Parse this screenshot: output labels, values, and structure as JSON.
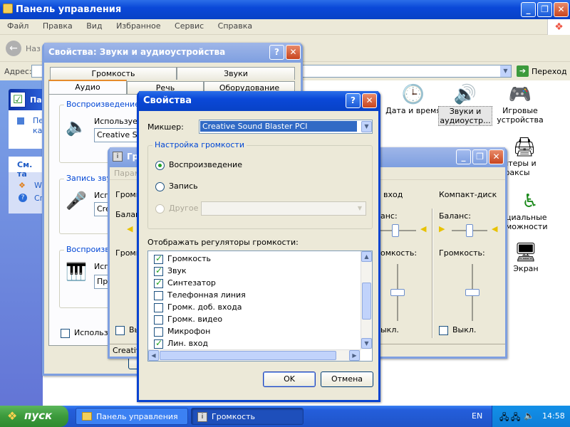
{
  "cp": {
    "title": "Панель управления",
    "menu": [
      "Файл",
      "Правка",
      "Вид",
      "Избранное",
      "Сервис",
      "Справка"
    ],
    "back_label": "Наз",
    "address_label": "Адрес:",
    "go_label": "Переход",
    "side_title": "Пан",
    "side_text1": "Пе",
    "side_text2": "ка",
    "see_also": "См. та",
    "side_link1": "W",
    "side_link2": "Сп",
    "icons": [
      {
        "label": "Дата и время",
        "icon": "clock-icon"
      },
      {
        "label": "Звуки и аудиоустр...",
        "icon": "speaker-icon"
      },
      {
        "label": "Игровые устройства",
        "icon": "gamepad-icon"
      },
      {
        "label": "нтеры и факсы",
        "icon": "printer-icon"
      },
      {
        "label": "циальные можности",
        "icon": "accessibility-icon"
      },
      {
        "label": "Экран",
        "icon": "display-icon"
      }
    ]
  },
  "sound": {
    "title": "Свойства: Звуки и аудиоустройства",
    "tabs_row1": [
      "Громкость",
      "Звуки"
    ],
    "tabs_row2": [
      "Аудио",
      "Речь",
      "Оборудование"
    ],
    "playback_group": "Воспроизведение з",
    "playback_using": "Используем",
    "playback_device": "Creative Sou",
    "record_group": "Запись звук",
    "record_using": "Испо",
    "record_device": "Cre",
    "midi_group": "Воспроизве",
    "midi_using": "Исп",
    "midi_device": "Про",
    "use_only": "Использов"
  },
  "volume": {
    "title": "Гро",
    "menu_param": "Парам",
    "col_left": "Громк",
    "balance_left": "Балан",
    "volume_left": "Громк",
    "mute_left": "Вык",
    "col_linein": "вход",
    "balance_linein": "анс:",
    "volume_linein": "омкость:",
    "mute_linein": "ыкл.",
    "col_cd": "Компакт-диск",
    "balance_cd": "Баланс:",
    "volume_cd": "Громкость:",
    "mute_cd": "Выкл.",
    "status": "Creative",
    "level_linein": 0.25,
    "level_cd": 0.25
  },
  "props": {
    "title": "Свойства",
    "mixer_label": "Микшер:",
    "mixer_value": "Creative Sound Blaster PCI",
    "group_label": "Настройка громкости",
    "radio_playback": "Воспроизведение",
    "radio_record": "Запись",
    "radio_other": "Другое",
    "selected_radio": "playback",
    "list_label": "Отображать регуляторы громкости:",
    "items": [
      {
        "label": "Громкость",
        "checked": true
      },
      {
        "label": "Звук",
        "checked": true
      },
      {
        "label": "Синтезатор",
        "checked": true
      },
      {
        "label": "Телефонная линия",
        "checked": false
      },
      {
        "label": "Громк. доб. входа",
        "checked": false
      },
      {
        "label": "Громк. видео",
        "checked": false
      },
      {
        "label": "Микрофон",
        "checked": false
      },
      {
        "label": "Лин. вход",
        "checked": true
      }
    ],
    "ok": "OK",
    "cancel": "Отмена"
  },
  "taskbar": {
    "start": "пуск",
    "tasks": [
      "Панель управления",
      "Громкость"
    ],
    "lang": "EN",
    "time": "14:58"
  },
  "colors": {
    "accent": "#0843d0",
    "taskbar": "#245edb",
    "start": "#3c9a3c"
  }
}
